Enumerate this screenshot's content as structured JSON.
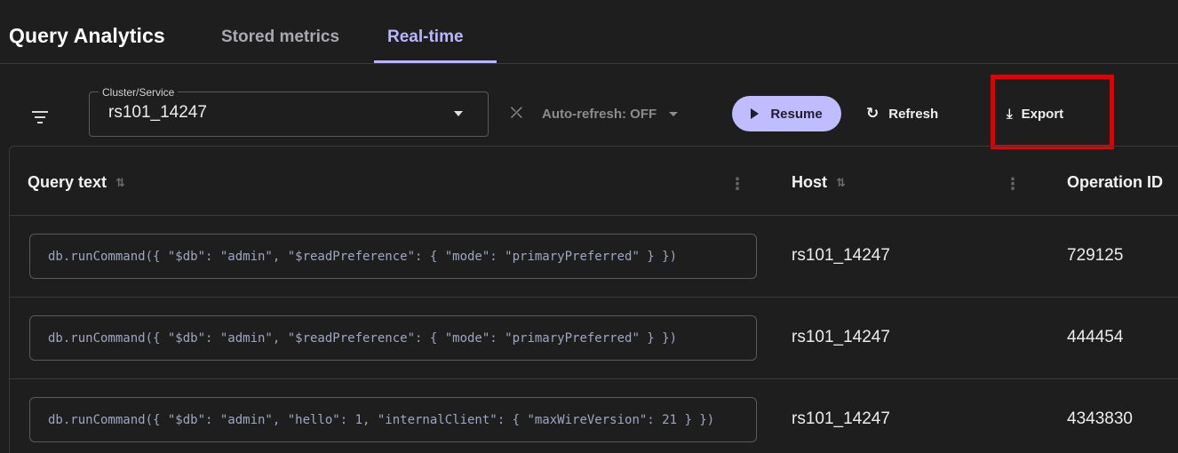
{
  "header": {
    "title": "Query Analytics",
    "tabs": [
      {
        "label": "Stored metrics",
        "active": false
      },
      {
        "label": "Real-time",
        "active": true
      }
    ]
  },
  "toolbar": {
    "filter_icon": "filter-lines-icon",
    "cluster_select": {
      "label": "Cluster/Service",
      "value": "rs101_14247"
    },
    "auto_refresh": {
      "label": "Auto-refresh: OFF",
      "icon": "sync-off-icon"
    },
    "resume_label": "Resume",
    "refresh_label": "Refresh",
    "export_label": "Export"
  },
  "table": {
    "columns": [
      "Query text",
      "Host",
      "Operation ID"
    ],
    "rows": [
      {
        "query": "db.runCommand({ \"$db\": \"admin\", \"$readPreference\": { \"mode\": \"primaryPreferred\" } })",
        "host": "rs101_14247",
        "opid": "729125"
      },
      {
        "query": "db.runCommand({ \"$db\": \"admin\", \"$readPreference\": { \"mode\": \"primaryPreferred\" } })",
        "host": "rs101_14247",
        "opid": "444454"
      },
      {
        "query": "db.runCommand({ \"$db\": \"admin\", \"hello\": 1, \"internalClient\": { \"maxWireVersion\": 21 } })",
        "host": "rs101_14247",
        "opid": "4343830"
      }
    ]
  },
  "colors": {
    "accent": "#b9b6ff",
    "button_fill": "#bfbcff",
    "highlight": "#e00000",
    "background": "#1e1e1e"
  }
}
